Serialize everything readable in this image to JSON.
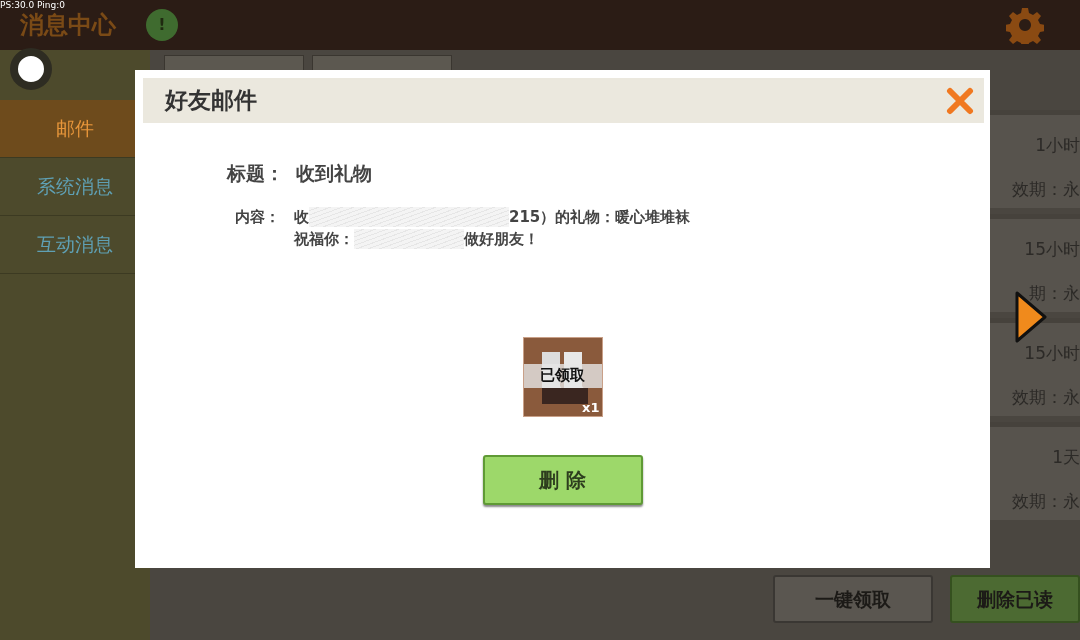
{
  "hud": "PS:30.0  Ping:0",
  "header": {
    "title": "消息中心",
    "alert": "!"
  },
  "sidebar": {
    "items": [
      {
        "label": "邮件",
        "selected": true
      },
      {
        "label": "系统消息",
        "selected": false
      },
      {
        "label": "互动消息",
        "selected": false
      }
    ]
  },
  "mail_list": [
    {
      "time": "1小时",
      "expiry": "效期：永"
    },
    {
      "time": "15小时",
      "expiry": "期：永"
    },
    {
      "time": "15小时",
      "expiry": "效期：永"
    },
    {
      "time": "1天",
      "expiry": "效期：永"
    }
  ],
  "actions": [
    {
      "label": "一键领取",
      "kind": "secondary"
    },
    {
      "label": "删除已读",
      "kind": "primary"
    }
  ],
  "dialog": {
    "title": "好友邮件",
    "subject_label": "标题：",
    "subject": "收到礼物",
    "content_label": "内容：",
    "content_lines": [
      [
        "收",
        "215）的礼物：暖心堆堆袜"
      ],
      [
        "祝福你：",
        "做好朋友！"
      ]
    ],
    "item": {
      "status": "已领取",
      "count": "x1"
    },
    "delete_button": "删 除"
  }
}
